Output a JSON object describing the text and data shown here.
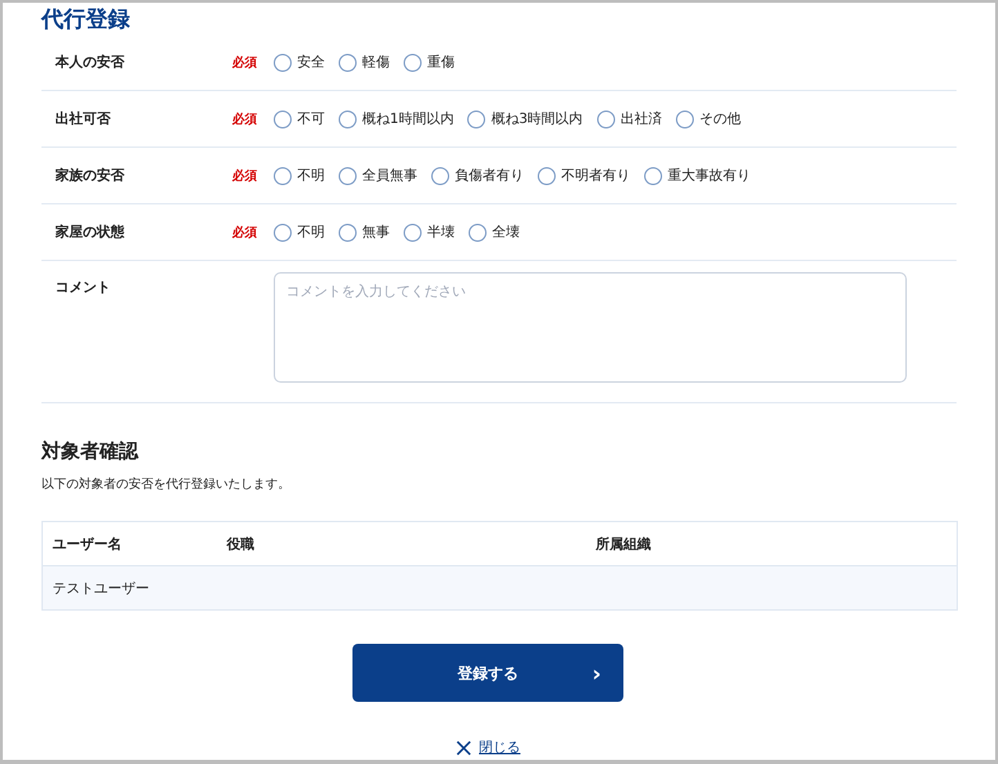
{
  "title": "代行登録",
  "questions": [
    {
      "label": "本人の安否",
      "required": "必須",
      "options": [
        {
          "label": "安全",
          "selected": false
        },
        {
          "label": "軽傷",
          "selected": false
        },
        {
          "label": "重傷",
          "selected": false
        }
      ]
    },
    {
      "label": "出社可否",
      "required": "必須",
      "options": [
        {
          "label": "不可",
          "selected": false
        },
        {
          "label": "概ね1時間以内",
          "selected": false
        },
        {
          "label": "概ね3時間以内",
          "selected": false
        },
        {
          "label": "出社済",
          "selected": false
        },
        {
          "label": "その他",
          "selected": false
        }
      ]
    },
    {
      "label": "家族の安否",
      "required": "必須",
      "options": [
        {
          "label": "不明",
          "selected": false
        },
        {
          "label": "全員無事",
          "selected": false
        },
        {
          "label": "負傷者有り",
          "selected": false
        },
        {
          "label": "不明者有り",
          "selected": false
        },
        {
          "label": "重大事故有り",
          "selected": false
        }
      ]
    },
    {
      "label": "家屋の状態",
      "required": "必須",
      "options": [
        {
          "label": "不明",
          "selected": false
        },
        {
          "label": "無事",
          "selected": false
        },
        {
          "label": "半壊",
          "selected": false
        },
        {
          "label": "全壊",
          "selected": false
        }
      ]
    }
  ],
  "comment": {
    "label": "コメント",
    "placeholder": "コメントを入力してください"
  },
  "confirm": {
    "title": "対象者確認",
    "description": "以下の対象者の安否を代行登録いたします。",
    "table": {
      "columns": [
        "ユーザー名",
        "役職",
        "所属組織"
      ],
      "rows": [
        [
          "テストユーザー"
        ]
      ]
    }
  },
  "submit_button": "登録する",
  "submit_icon": "›",
  "close_link": "閉じる"
}
